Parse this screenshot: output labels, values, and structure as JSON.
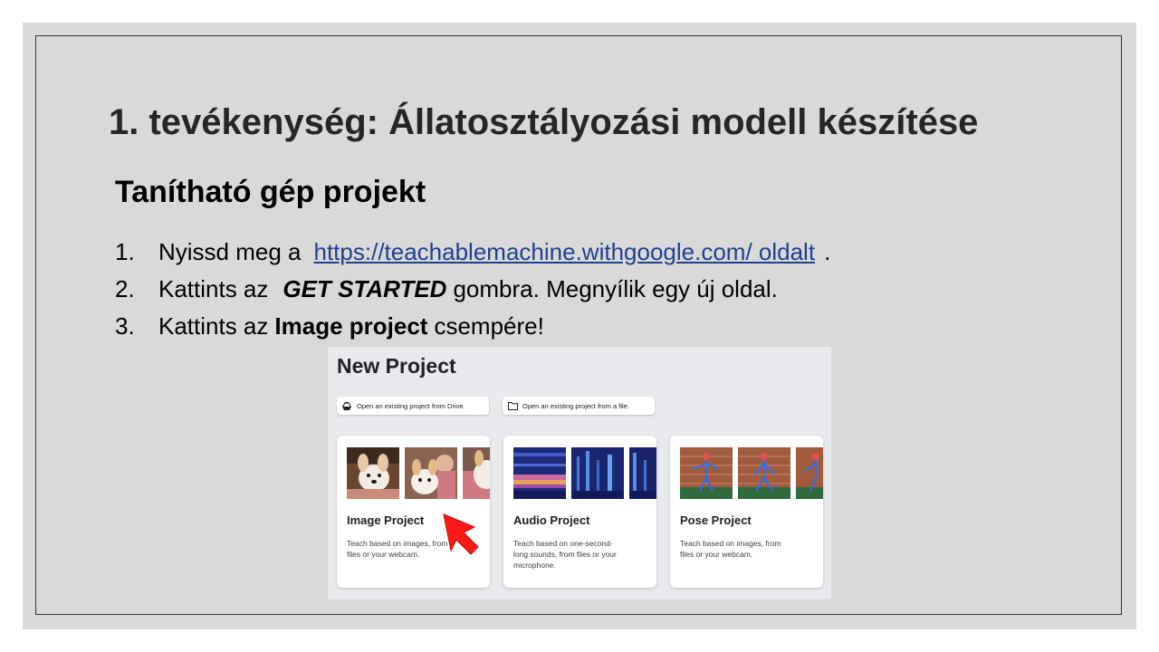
{
  "slide": {
    "title": "1. tevékenység: Állatosztályozási modell készítése",
    "subtitle": "Tanítható gép projekt",
    "steps": [
      {
        "num": "1.",
        "before": "Nyissd meg a",
        "link": "https://teachablemachine.withgoogle.com/  oldalt",
        "after": "."
      },
      {
        "num": "2.",
        "before": "Kattints az",
        "emphasis": "GET STARTED",
        "after": "gombra. Megnyílik egy új oldal."
      },
      {
        "num": "3.",
        "before": "Kattints az",
        "bold": "Image project",
        "after": "csempére!"
      }
    ]
  },
  "screenshot": {
    "title": "New Project",
    "open_drive": {
      "label": "Open an existing project from Drive.",
      "icon": "drive-icon"
    },
    "open_file": {
      "label": "Open an existing project from a file.",
      "icon": "folder-icon"
    },
    "cards": [
      {
        "title": "Image Project",
        "description": "Teach based on images, from files or your webcam.",
        "thumbs": [
          "dog-plush-photo",
          "dog-plush-photo",
          "dog-plush-photo"
        ]
      },
      {
        "title": "Audio Project",
        "description": "Teach based on one-second-long sounds, from files or your microphone.",
        "thumbs": [
          "spectrogram",
          "spectrogram",
          "spectrogram"
        ]
      },
      {
        "title": "Pose Project",
        "description": "Teach based on images, from files or your webcam.",
        "thumbs": [
          "pose-skeleton-photo",
          "pose-skeleton-photo",
          "pose-skeleton-photo"
        ]
      }
    ],
    "cursor_icon": "red-arrow-cursor-icon"
  },
  "colors": {
    "slide_bg": "#d9d9d9",
    "title": "#262626",
    "link": "#1f3f8f",
    "panel_bg": "#e8eaed",
    "cursor": "#ff1a1a"
  }
}
